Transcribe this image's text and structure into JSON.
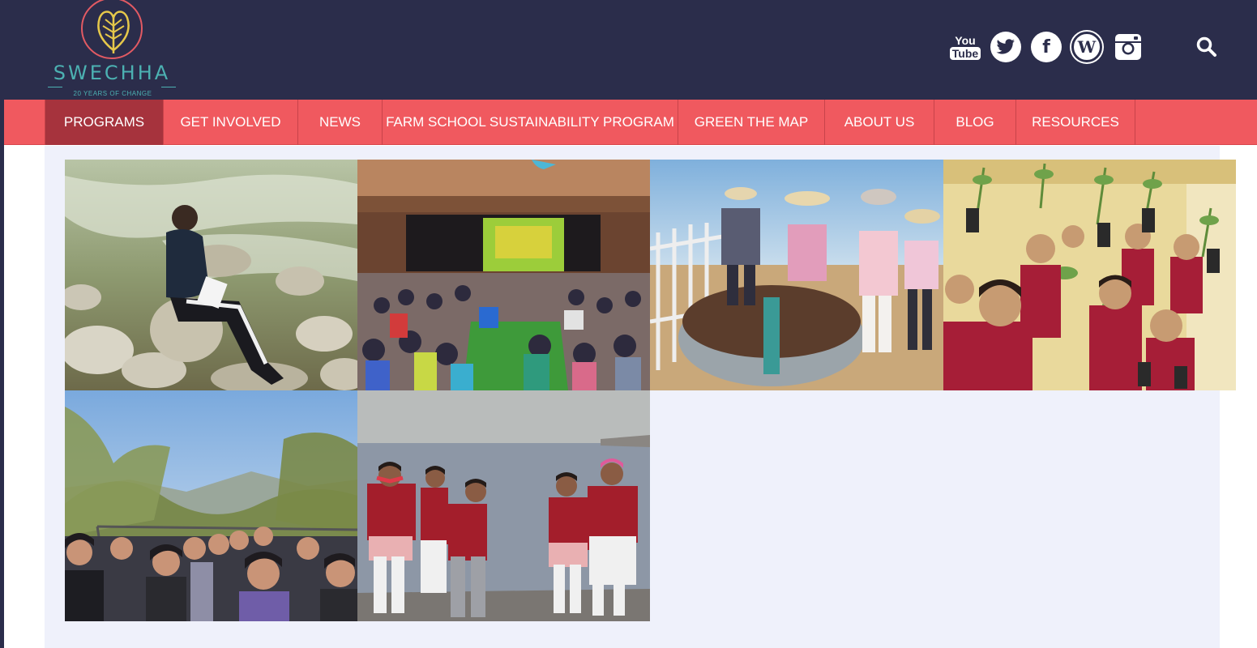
{
  "brand": {
    "name": "SWECHHA",
    "tagline": "20 YEARS OF CHANGE",
    "colors": {
      "header_bg": "#2b2d4b",
      "accent": "#f0595f",
      "active": "#a6333d",
      "teal": "#4cb1b2"
    }
  },
  "header": {
    "social": [
      {
        "name": "youtube-icon",
        "label": "You",
        "label2": "Tube"
      },
      {
        "name": "twitter-icon"
      },
      {
        "name": "facebook-icon",
        "label": "f"
      },
      {
        "name": "wordpress-icon",
        "label": "W"
      },
      {
        "name": "instagram-icon"
      }
    ],
    "search_icon": "search-icon"
  },
  "nav": {
    "items": [
      {
        "label": "PROGRAMS",
        "active": true
      },
      {
        "label": "GET INVOLVED"
      },
      {
        "label": "NEWS"
      },
      {
        "label": "FARM SCHOOL SUSTAINABILITY PROGRAM"
      },
      {
        "label": "GREEN THE MAP"
      },
      {
        "label": "ABOUT US"
      },
      {
        "label": "BLOG"
      },
      {
        "label": "RESOURCES"
      }
    ]
  },
  "gallery": {
    "images": [
      {
        "name": "photo-girl-writing-by-river"
      },
      {
        "name": "photo-children-auditorium"
      },
      {
        "name": "photo-beekeeping-children"
      },
      {
        "name": "photo-students-holding-saplings"
      },
      {
        "name": "photo-students-open-bus"
      },
      {
        "name": "photo-students-by-lake"
      }
    ]
  }
}
